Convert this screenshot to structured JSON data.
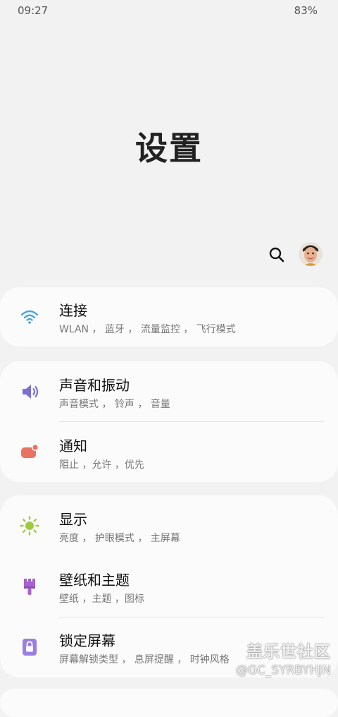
{
  "status_bar": {
    "time": "09:27",
    "battery": "83%"
  },
  "header": {
    "title": "设置"
  },
  "sections": [
    {
      "items": [
        {
          "title": "连接",
          "subtitle": "WLAN ， 蓝牙 ， 流量监控 ， 飞行模式",
          "icon": "wifi-icon",
          "icon_color": "#4aa3e0"
        }
      ]
    },
    {
      "items": [
        {
          "title": "声音和振动",
          "subtitle": "声音模式 ， 铃声 ， 音量",
          "icon": "volume-icon",
          "icon_color": "#7b6fd6"
        },
        {
          "title": "通知",
          "subtitle": "阻止 ，允许 ，优先",
          "icon": "notification-icon",
          "icon_color": "#ea7260"
        }
      ]
    },
    {
      "items": [
        {
          "title": "显示",
          "subtitle": "亮度 ， 护眼模式 ， 主屏幕",
          "icon": "brightness-icon",
          "icon_color": "#9ccc3b"
        },
        {
          "title": "壁纸和主题",
          "subtitle": "壁纸 ，主题 ，图标",
          "icon": "brush-icon",
          "icon_color": "#a563cf"
        },
        {
          "title": "锁定屏幕",
          "subtitle": "屏幕解锁类型 ， 息屏提醒 ， 时钟风格",
          "icon": "lock-icon",
          "icon_color": "#9b7fe0"
        }
      ]
    }
  ],
  "watermark": {
    "logo": "盖乐世社区",
    "user": "@GC_SYRBYHJN"
  }
}
